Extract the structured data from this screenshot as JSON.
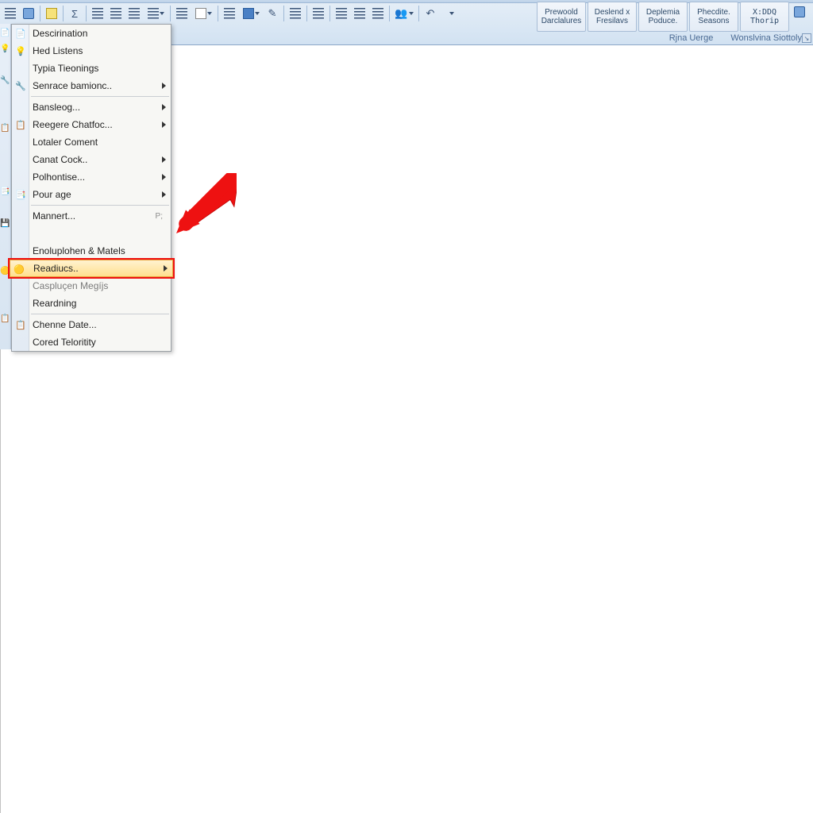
{
  "ribbon": {
    "groups": [
      {
        "line1": "Prewoold",
        "line2": "Darclalures"
      },
      {
        "line1": "Deslend x",
        "line2": "Fresilavs"
      },
      {
        "line1": "Deplemia",
        "line2": "Poduce."
      },
      {
        "line1": "Phecdite.",
        "line2": "Seasons"
      },
      {
        "line1": "X:DDQ",
        "line2": "Thorip"
      }
    ],
    "sublabels": {
      "left": "Rjna Uerge",
      "right": "Wonslvina Siottoly"
    }
  },
  "menu": {
    "items": [
      {
        "label": "Descirination",
        "icon": "📄",
        "submenu": false
      },
      {
        "label": "Hed Listens",
        "icon": "💡",
        "submenu": false
      },
      {
        "label": "Typia Tieonings",
        "icon": "",
        "submenu": false
      },
      {
        "label": "Senrace bamionc..",
        "icon": "🔧",
        "submenu": true
      },
      {
        "sep": true
      },
      {
        "label": "Bansleog...",
        "icon": "",
        "submenu": true
      },
      {
        "label": "Reegere Chatfoc...",
        "icon": "📋",
        "submenu": true
      },
      {
        "label": "Lotaler Coment",
        "icon": "",
        "submenu": false
      },
      {
        "label": "Canat Cock..",
        "icon": "",
        "submenu": true
      },
      {
        "label": "Polhontise...",
        "icon": "",
        "submenu": true
      },
      {
        "label": "Pour age",
        "icon": "📑",
        "submenu": true
      },
      {
        "sep": true
      },
      {
        "label": "Mannert...",
        "icon": "",
        "submenu": false,
        "shortcut": "P;"
      },
      {
        "label": "",
        "icon": "",
        "submenu": false,
        "cut": true
      },
      {
        "label": "Enoluplohen & Matels",
        "icon": "",
        "submenu": false
      },
      {
        "label": "Readiucs..",
        "icon": "🟡",
        "submenu": true,
        "highlight": true
      },
      {
        "label": "Caspluçen Megíjs",
        "icon": "",
        "submenu": false,
        "cut": true
      },
      {
        "label": "Reardning",
        "icon": "",
        "submenu": false
      },
      {
        "sep": true
      },
      {
        "label": "Chenne Date...",
        "icon": "📋",
        "submenu": false
      },
      {
        "label": "Cored Teloritity",
        "icon": "",
        "submenu": false
      }
    ]
  },
  "toolbar_icons": [
    "menu-icon",
    "table-icon",
    "paste-icon",
    "sigma-icon",
    "align-left-icon",
    "align-center-icon",
    "align-right-icon",
    "paragraph-icon",
    "list-icon",
    "page-icon",
    "border-icon",
    "justify-icon",
    "fill-icon",
    "fill-dd-icon",
    "pen-icon",
    "indent-left-icon",
    "text-align-icon",
    "indent-right-icon",
    "columns-icon",
    "rows-icon",
    "people-icon",
    "undo-icon",
    "redo-icon"
  ]
}
